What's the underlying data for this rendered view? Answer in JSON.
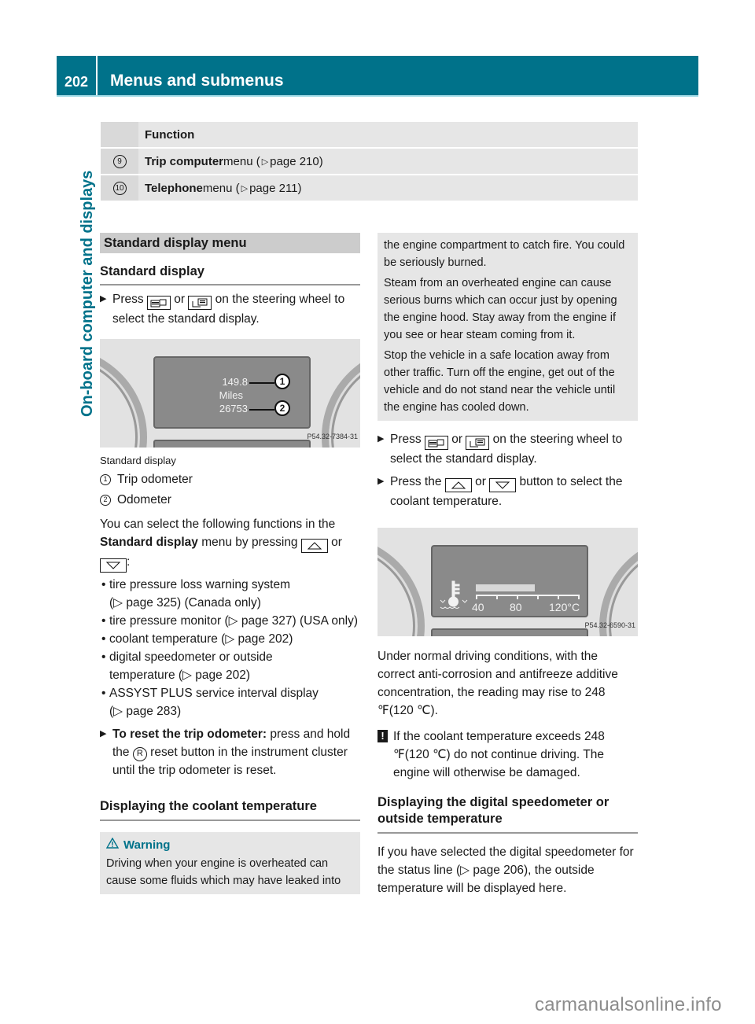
{
  "header": {
    "page_number": "202",
    "title": "Menus and submenus",
    "color": "#00728a"
  },
  "side_tab": {
    "label": "On-board computer and displays"
  },
  "function_table": {
    "header": "Function",
    "rows": [
      {
        "number": "9",
        "bold": "Trip computer",
        "text": " menu (",
        "ref": " page 210)"
      },
      {
        "number": "10",
        "bold": "Telephone",
        "text": " menu (",
        "ref": " page 211)"
      }
    ]
  },
  "left": {
    "section_title": "Standard display menu",
    "subheading": "Standard display",
    "step1": {
      "pre": "Press ",
      "mid": " or ",
      "post": " on the steering wheel to select the standard display."
    },
    "figure1": {
      "trip_value": "149.8",
      "unit": "Miles",
      "odometer_value": "26753",
      "callout1": "1",
      "callout2": "2",
      "code": "P54.32-7384-31"
    },
    "caption": "Standard display",
    "legend": [
      {
        "num": "1",
        "label": "Trip odometer"
      },
      {
        "num": "2",
        "label": "Odometer"
      }
    ],
    "intro": {
      "pre": "You can select the following functions in the ",
      "bold": "Standard display",
      "mid": " menu by pressing ",
      "or": " or ",
      "post": ":"
    },
    "bullets": [
      {
        "text": "tire pressure loss warning system",
        "ref": "(▷ page 325) (Canada only)"
      },
      {
        "text": "tire pressure monitor (▷ page 327) (USA only)",
        "ref": ""
      },
      {
        "text": "coolant temperature (▷ page 202)",
        "ref": ""
      },
      {
        "text": "digital speedometer or outside",
        "ref": "temperature (▷ page 202)"
      },
      {
        "text": "ASSYST PLUS service interval display",
        "ref": "(▷ page 283)"
      }
    ],
    "reset_step": {
      "bold": "To reset the trip odometer:",
      "pre": " press and hold the ",
      "button": "R",
      "post": " reset button in the instrument cluster until the trip odometer is reset."
    },
    "coolant_heading": "Displaying the coolant temperature",
    "warning": {
      "title": "Warning",
      "text": "Driving when your engine is overheated can cause some fluids which may have leaked into"
    }
  },
  "right": {
    "warning_cont": [
      "the engine compartment to catch fire. You could be seriously burned.",
      "Steam from an overheated engine can cause serious burns which can occur just by opening the engine hood. Stay away from the engine if you see or hear steam coming from it.",
      "Stop the vehicle in a safe location away from other traffic. Turn off the engine, get out of the vehicle and do not stand near the vehicle until the engine has cooled down."
    ],
    "step1": {
      "pre": "Press ",
      "mid": " or ",
      "post": " on the steering wheel to select the standard display."
    },
    "step2": {
      "pre": "Press the ",
      "mid": " or ",
      "post": " button to select the coolant temperature."
    },
    "figure2": {
      "scale_labels": [
        "40",
        "80",
        "120°C"
      ],
      "fill_fraction": 0.58,
      "code": "P54.32-6590-31"
    },
    "para1": "Under normal driving conditions, with the correct anti-corrosion and antifreeze additive concentration, the reading may rise to 248 ℉(120 ℃).",
    "note": "If the coolant temperature exceeds 248 ℉(120 ℃) do not continue driving. The engine will otherwise be damaged.",
    "heading2": "Displaying the digital speedometer or outside temperature",
    "para2": {
      "pre": "If you have selected the digital speedometer for the status line (",
      "ref": "▷ page 206",
      "post": "), the outside temperature will be displayed here."
    }
  },
  "watermark": "carmanualsonline.info"
}
